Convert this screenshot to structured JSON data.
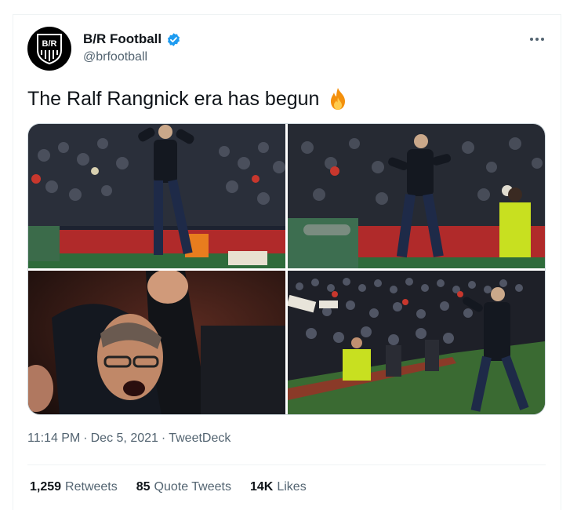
{
  "author": {
    "display_name": "B/R Football",
    "handle": "@brfootball",
    "avatar_text": "B/R",
    "verified_color": "#1d9bf0"
  },
  "tweet": {
    "text": "The Ralf Rangnick era has begun",
    "emoji_icon": "fire-emoji",
    "images": [
      {
        "name": "celebration-fists-raised"
      },
      {
        "name": "celebration-fist-pump-touchline"
      },
      {
        "name": "celebration-closeup-shout"
      },
      {
        "name": "celebration-wide-stadium"
      }
    ]
  },
  "meta": {
    "time": "11:14 PM",
    "separator": "·",
    "date": "Dec 5, 2021",
    "source": "TweetDeck"
  },
  "stats": {
    "retweets_count": "1,259",
    "retweets_label": "Retweets",
    "quotes_count": "85",
    "quotes_label": "Quote Tweets",
    "likes_count": "14K",
    "likes_label": "Likes"
  }
}
